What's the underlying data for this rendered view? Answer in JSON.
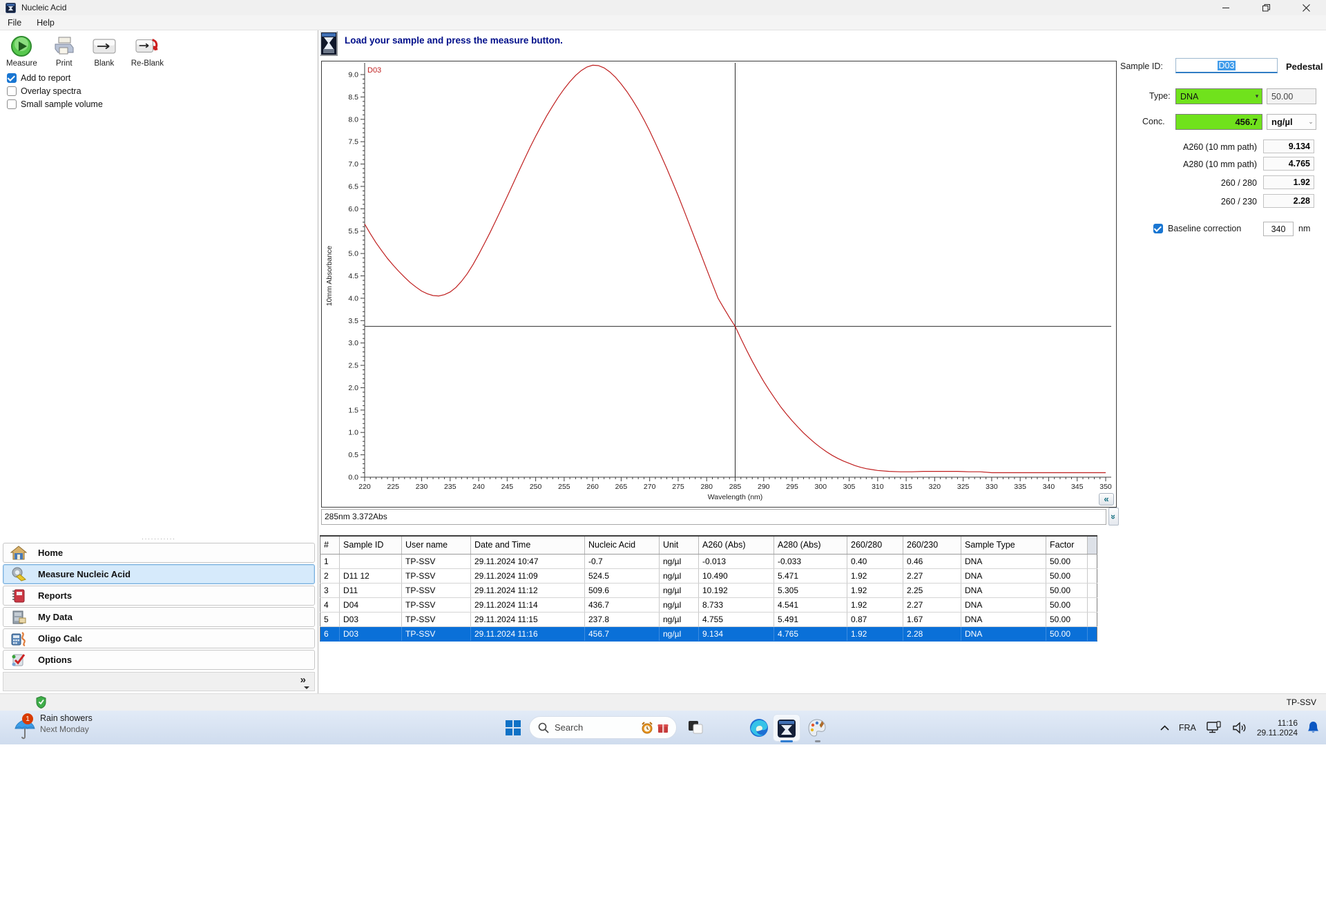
{
  "window": {
    "title": "Nucleic Acid"
  },
  "menu": {
    "items": [
      "File",
      "Help"
    ]
  },
  "toolbar": {
    "buttons": [
      {
        "id": "measure",
        "label": "Measure"
      },
      {
        "id": "print",
        "label": "Print"
      },
      {
        "id": "blank",
        "label": "Blank"
      },
      {
        "id": "reblank",
        "label": "Re-Blank"
      }
    ]
  },
  "options": {
    "checkboxes": [
      {
        "label": "Add to report",
        "checked": true
      },
      {
        "label": "Overlay spectra",
        "checked": false
      },
      {
        "label": "Small sample volume",
        "checked": false
      }
    ]
  },
  "sidebar": {
    "items": [
      {
        "label": "Home",
        "icon": "home-icon",
        "selected": false
      },
      {
        "label": "Measure Nucleic Acid",
        "icon": "measure-nucleic-acid-icon",
        "selected": true
      },
      {
        "label": "Reports",
        "icon": "reports-icon",
        "selected": false
      },
      {
        "label": "My Data",
        "icon": "my-data-icon",
        "selected": false
      },
      {
        "label": "Oligo Calc",
        "icon": "oligo-calc-icon",
        "selected": false
      },
      {
        "label": "Options",
        "icon": "options-icon",
        "selected": false
      }
    ],
    "expander_glyph": "»"
  },
  "message_bar": {
    "text": "Load your sample and press the measure button."
  },
  "chart_data": {
    "type": "line",
    "xlabel": "Wavelength (nm)",
    "ylabel": "10mm Absorbance",
    "xlim": [
      220,
      350
    ],
    "ylim": [
      0,
      9.28
    ],
    "xtick_step": 5,
    "xtick_minor_step": 1,
    "ytick_step": 0.5,
    "ytick_minor_step": 0.1,
    "grid": false,
    "annotation": "D03",
    "curve_color": "#bf1e1e",
    "cursor": {
      "x": 285,
      "y": 3.372,
      "readout": "285nm 3.372Abs"
    },
    "series": [
      {
        "name": "D03",
        "x": [
          220,
          221,
          222,
          223,
          224,
          225,
          226,
          227,
          228,
          229,
          230,
          231,
          232,
          233,
          234,
          235,
          236,
          237,
          238,
          239,
          240,
          241,
          242,
          243,
          244,
          245,
          246,
          247,
          248,
          249,
          250,
          251,
          252,
          253,
          254,
          255,
          256,
          257,
          258,
          259,
          260,
          261,
          262,
          263,
          264,
          265,
          266,
          267,
          268,
          269,
          270,
          271,
          272,
          273,
          274,
          275,
          276,
          277,
          278,
          279,
          280,
          281,
          282,
          283,
          284,
          285,
          286,
          287,
          288,
          289,
          290,
          291,
          292,
          293,
          294,
          295,
          296,
          297,
          298,
          299,
          300,
          301,
          302,
          303,
          304,
          305,
          306,
          307,
          308,
          309,
          310,
          312,
          314,
          316,
          318,
          320,
          322,
          324,
          326,
          328,
          330,
          332,
          334,
          336,
          338,
          340,
          342,
          344,
          346,
          348,
          350
        ],
        "y": [
          5.66,
          5.44,
          5.24,
          5.06,
          4.89,
          4.74,
          4.6,
          4.47,
          4.35,
          4.25,
          4.16,
          4.1,
          4.06,
          4.05,
          4.08,
          4.14,
          4.24,
          4.38,
          4.55,
          4.75,
          4.98,
          5.22,
          5.47,
          5.73,
          6.0,
          6.27,
          6.55,
          6.83,
          7.1,
          7.37,
          7.62,
          7.86,
          8.09,
          8.3,
          8.5,
          8.68,
          8.84,
          8.98,
          9.09,
          9.17,
          9.21,
          9.2,
          9.15,
          9.06,
          8.94,
          8.79,
          8.62,
          8.43,
          8.22,
          7.99,
          7.74,
          7.47,
          7.19,
          6.9,
          6.6,
          6.29,
          5.97,
          5.64,
          5.31,
          4.98,
          4.65,
          4.32,
          4.0,
          3.78,
          3.57,
          3.37,
          3.1,
          2.84,
          2.59,
          2.36,
          2.14,
          1.94,
          1.75,
          1.57,
          1.41,
          1.26,
          1.12,
          0.99,
          0.87,
          0.76,
          0.66,
          0.57,
          0.49,
          0.42,
          0.36,
          0.31,
          0.26,
          0.22,
          0.19,
          0.17,
          0.15,
          0.13,
          0.12,
          0.12,
          0.13,
          0.13,
          0.13,
          0.13,
          0.12,
          0.12,
          0.1,
          0.1,
          0.1,
          0.1,
          0.1,
          0.1,
          0.1,
          0.1,
          0.1,
          0.1,
          0.1
        ]
      }
    ]
  },
  "collapse_glyph": "«",
  "expand_down_glyph": "»",
  "cursor_readout": "285nm 3.372Abs",
  "sample_panel": {
    "sample_id_label": "Sample ID:",
    "sample_id_value": "D03",
    "mode_label": "Pedestal",
    "type_label": "Type:",
    "type_value": "DNA",
    "type_factor": "50.00",
    "conc_label": "Conc.",
    "conc_value": "456.7",
    "conc_unit": "ng/µl",
    "rows": [
      {
        "label": "A260 (10 mm path)",
        "value": "9.134"
      },
      {
        "label": "A280 (10 mm path)",
        "value": "4.765"
      },
      {
        "label": "260 / 280",
        "value": "1.92"
      },
      {
        "label": "260 / 230",
        "value": "2.28"
      }
    ],
    "baseline": {
      "label": "Baseline correction",
      "checked": true,
      "value": "340",
      "unit": "nm"
    }
  },
  "results_table": {
    "columns": [
      "#",
      "Sample ID",
      "User name",
      "Date and Time",
      "Nucleic Acid",
      "Unit",
      "A260 (Abs)",
      "A280 (Abs)",
      "260/280",
      "260/230",
      "Sample Type",
      "Factor"
    ],
    "rows": [
      [
        "1",
        "",
        "TP-SSV",
        "29.11.2024 10:47",
        "-0.7",
        "ng/µl",
        "-0.013",
        "-0.033",
        "0.40",
        "0.46",
        "DNA",
        "50.00"
      ],
      [
        "2",
        "D11 12",
        "TP-SSV",
        "29.11.2024 11:09",
        "524.5",
        "ng/µl",
        "10.490",
        "5.471",
        "1.92",
        "2.27",
        "DNA",
        "50.00"
      ],
      [
        "3",
        "D11",
        "TP-SSV",
        "29.11.2024 11:12",
        "509.6",
        "ng/µl",
        "10.192",
        "5.305",
        "1.92",
        "2.25",
        "DNA",
        "50.00"
      ],
      [
        "4",
        "D04",
        "TP-SSV",
        "29.11.2024 11:14",
        "436.7",
        "ng/µl",
        "8.733",
        "4.541",
        "1.92",
        "2.27",
        "DNA",
        "50.00"
      ],
      [
        "5",
        "D03",
        "TP-SSV",
        "29.11.2024 11:15",
        "237.8",
        "ng/µl",
        "4.755",
        "5.491",
        "0.87",
        "1.67",
        "DNA",
        "50.00"
      ],
      [
        "6",
        "D03",
        "TP-SSV",
        "29.11.2024 11:16",
        "456.7",
        "ng/µl",
        "9.134",
        "4.765",
        "1.92",
        "2.28",
        "DNA",
        "50.00"
      ]
    ],
    "selected_row_index": 5
  },
  "status_bar": {
    "user": "TP-SSV"
  },
  "taskbar": {
    "weather": {
      "badge": "1",
      "line1": "Rain showers",
      "line2": "Next Monday"
    },
    "search": {
      "placeholder": "Search"
    },
    "tray": {
      "language": "FRA",
      "time": "11:16",
      "date": "29.11.2024"
    }
  },
  "colors": {
    "accent": "#0a70d8",
    "highlight_green": "#70e21c",
    "curve_red": "#bf1e1e",
    "navy_message": "#000f8a"
  }
}
